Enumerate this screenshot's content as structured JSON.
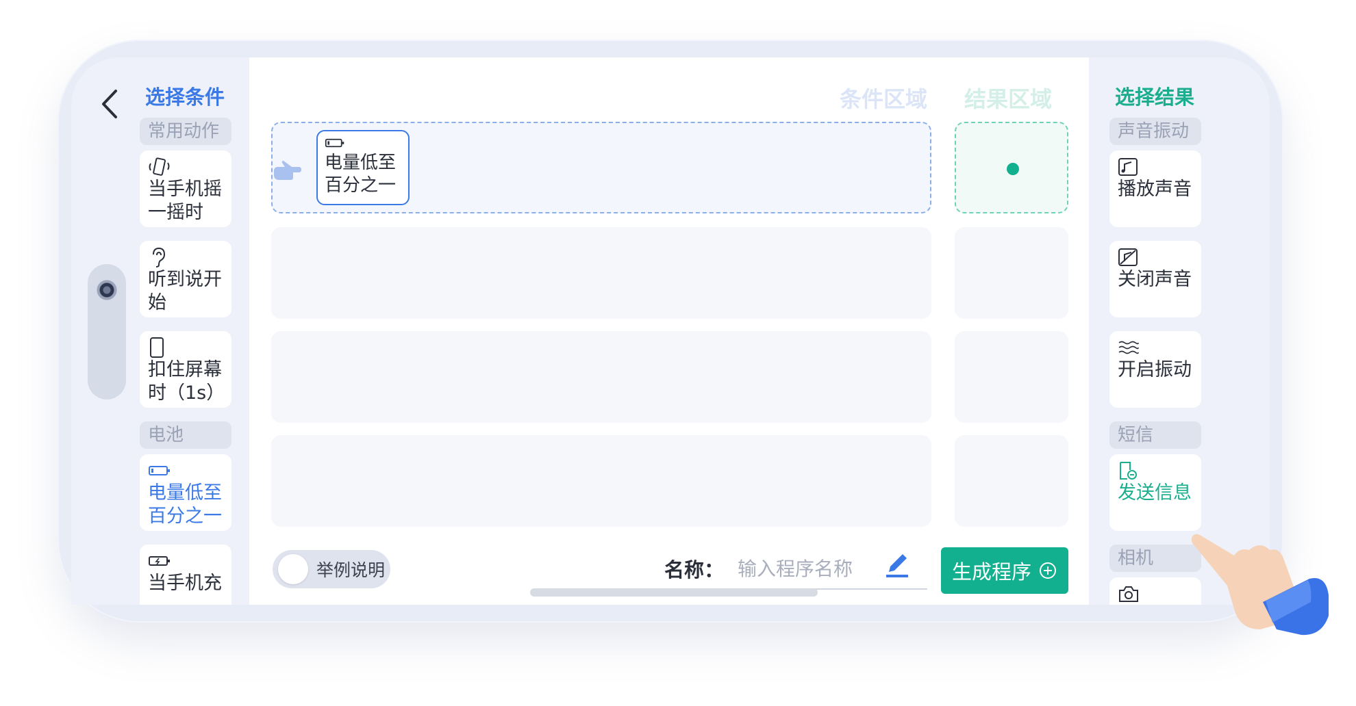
{
  "header": {
    "left_title": "选择条件",
    "right_title": "选择结果"
  },
  "left": {
    "sections": [
      {
        "title": "常用动作",
        "items": [
          {
            "label": "当手机摇一摇时",
            "icon": "shake-phone-icon"
          },
          {
            "label": "听到说开始",
            "icon": "ear-icon"
          },
          {
            "label": "扣住屏幕时（1s）",
            "icon": "phone-face-down-icon"
          }
        ]
      },
      {
        "title": "电池",
        "items": [
          {
            "label": "电量低至百分之一",
            "icon": "battery-low-icon",
            "selected": true
          },
          {
            "label": "当手机充",
            "icon": "battery-charging-icon"
          }
        ]
      }
    ]
  },
  "right": {
    "sections": [
      {
        "title": "声音振动",
        "items": [
          {
            "label": "播放声音",
            "icon": "music-icon"
          },
          {
            "label": "关闭声音",
            "icon": "mute-icon"
          },
          {
            "label": "开启振动",
            "icon": "vibrate-icon"
          }
        ]
      },
      {
        "title": "短信",
        "items": [
          {
            "label": "发送信息",
            "icon": "send-message-icon",
            "selected": true
          }
        ]
      },
      {
        "title": "相机",
        "items": [
          {
            "label": "",
            "icon": "camera-icon"
          }
        ]
      }
    ]
  },
  "center": {
    "condition_label": "条件区域",
    "result_label": "结果区域",
    "placed_condition": "电量低至百分之一",
    "example_toggle": "举例说明",
    "name_key": "名称：",
    "name_placeholder": "输入程序名称",
    "generate_button": "生成程序"
  },
  "colors": {
    "blue": "#3a79e6",
    "green": "#12b08f"
  }
}
